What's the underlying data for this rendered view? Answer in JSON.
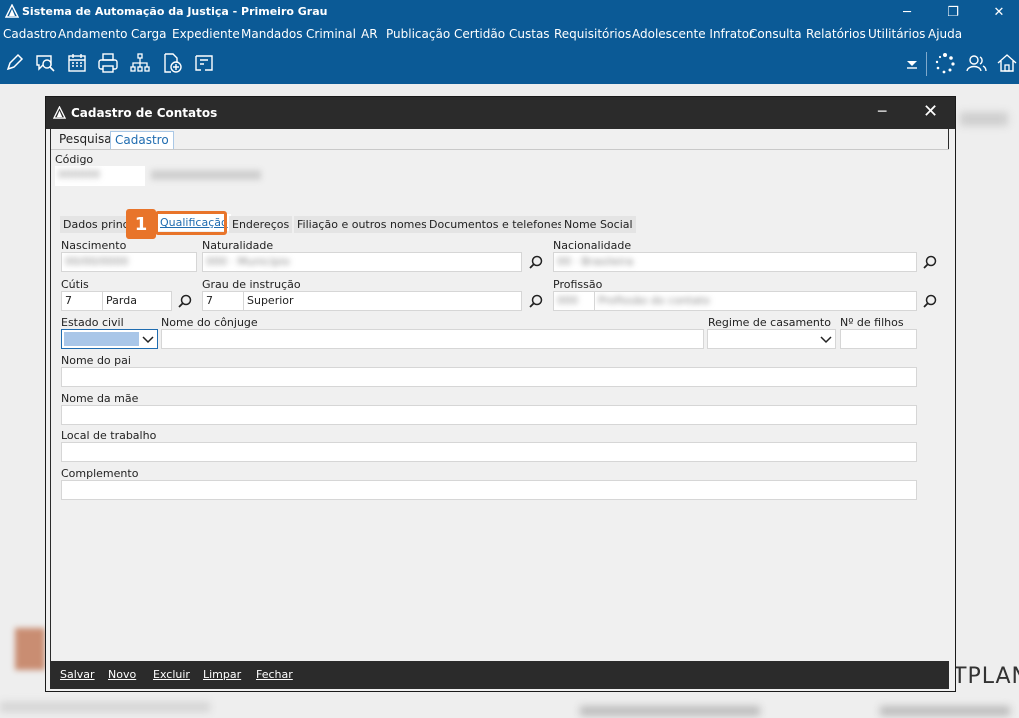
{
  "window": {
    "title": "Sistema de Automação da Justiça - Primeiro Grau",
    "controls": {
      "minimize": "─",
      "restore": "❐",
      "close": "✕"
    }
  },
  "menu": [
    "Cadastro",
    "Andamento",
    "Carga",
    "Expediente",
    "Mandados",
    "Criminal",
    "AR",
    "Publicação",
    "Certidão",
    "Custas",
    "Requisitórios",
    "Adolescente Infrator",
    "Consulta",
    "Relatórios",
    "Utilitários",
    "Ajuda"
  ],
  "toolbar": {
    "icons": [
      "edit-icon",
      "search-chat-icon",
      "calendar-icon",
      "printer-icon",
      "org-chart-icon",
      "add-document-icon",
      "map-icon",
      "dropdown-icon",
      "loading-icon",
      "users-icon",
      "home-icon"
    ]
  },
  "background": {
    "brand_text": "TPLAN"
  },
  "dialog": {
    "title": "Cadastro de Contatos",
    "min": "─",
    "close": "✕",
    "tabs": [
      "Pesquisa",
      "Cadastro"
    ],
    "active_tab": "Cadastro",
    "codigo_label": "Código",
    "subtabs": [
      "Dados princ",
      "Qualificação",
      "Endereços",
      "Filiação e outros nomes",
      "Documentos e telefones",
      "Nome Social"
    ],
    "active_subtab": "Qualificação",
    "callout_number": "1",
    "fields": {
      "nascimento_label": "Nascimento",
      "naturalidade_label": "Naturalidade",
      "nacionalidade_label": "Nacionalidade",
      "cutis_label": "Cútis",
      "cutis_code": "7",
      "cutis_value": "Parda",
      "grau_label": "Grau de instrução",
      "grau_code": "7",
      "grau_value": "Superior",
      "profissao_label": "Profissão",
      "estado_civil_label": "Estado civil",
      "nome_conjuge_label": "Nome do cônjuge",
      "regime_label": "Regime de casamento",
      "filhos_label": "Nº de filhos",
      "nome_pai_label": "Nome do pai",
      "nome_mae_label": "Nome da mãe",
      "local_trabalho_label": "Local de trabalho",
      "complemento_label": "Complemento"
    },
    "footer": [
      "Salvar",
      "Novo",
      "Excluir",
      "Limpar",
      "Fechar"
    ]
  },
  "colors": {
    "titlebar": "#0b5a96",
    "dialog_title": "#2b2b2b",
    "accent": "#e8742a",
    "link": "#1f6cb0"
  }
}
